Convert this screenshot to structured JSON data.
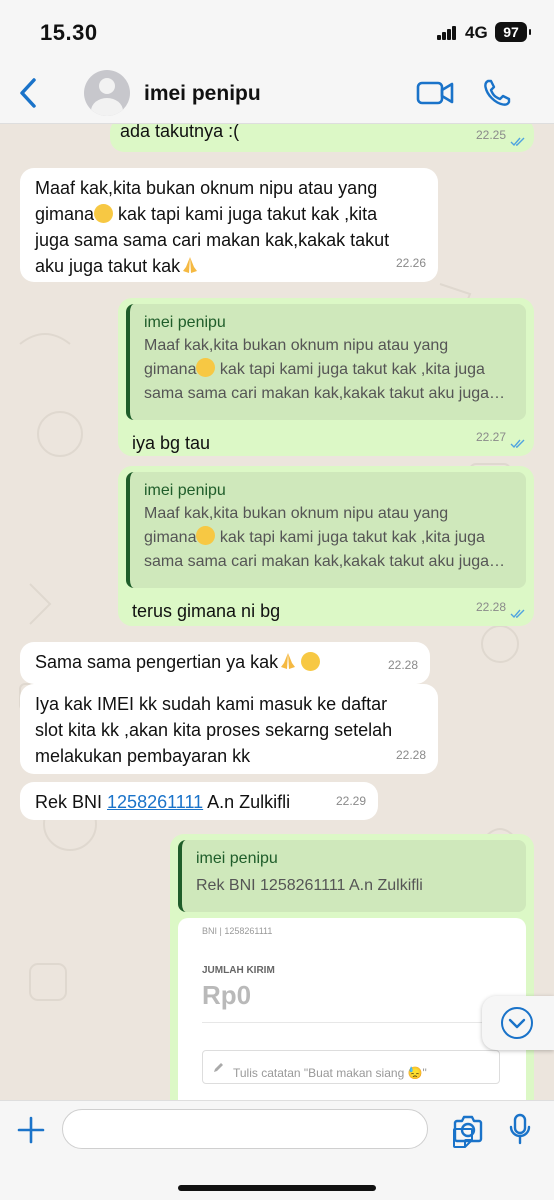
{
  "status_bar": {
    "time": "15.30",
    "network": "4G",
    "battery": "97"
  },
  "header": {
    "contact_name": "imei penipu"
  },
  "messages": [
    {
      "type": "out",
      "text": "ada takutnya :(",
      "time": "22.25"
    },
    {
      "type": "in",
      "lines": [
        "Maaf kak,kita bukan oknum nipu atau yang",
        "gimana",
        " kak tapi kami juga takut kak ,kita",
        "juga sama sama cari makan kak,kakak takut",
        "aku juga takut kak"
      ],
      "time": "22.26"
    },
    {
      "type": "out",
      "quote_name": "imei penipu",
      "quote_lines": [
        "Maaf kak,kita bukan oknum nipu atau yang",
        "gimana",
        " kak tapi kami juga takut kak ,kita juga",
        "sama sama cari makan kak,kakak takut aku juga…"
      ],
      "text": "iya bg tau",
      "time": "22.27"
    },
    {
      "type": "out",
      "quote_name": "imei penipu",
      "quote_lines": [
        "Maaf kak,kita bukan oknum nipu atau yang",
        "gimana",
        " kak tapi kami juga takut kak ,kita juga",
        "sama sama cari makan kak,kakak takut aku juga…"
      ],
      "text": "terus gimana ni bg",
      "time": "22.28"
    },
    {
      "type": "in",
      "text": "Sama sama pengertian ya kak",
      "time": "22.28"
    },
    {
      "type": "in",
      "lines": [
        "Iya kak IMEI kk sudah kami masuk ke daftar",
        "slot kita kk ,akan kita proses sekarng setelah",
        "melakukan pembayaran kk"
      ],
      "time": "22.28"
    },
    {
      "type": "in",
      "prefix": "Rek BNI ",
      "link": "1258261111",
      "suffix": " A.n Zulkifli",
      "time": "22.29"
    },
    {
      "type": "out",
      "quote_name": "imei penipu",
      "quote_text": "Rek BNI 1258261111 A.n Zulkifli",
      "image": {
        "top_text": "BNI | 1258261111",
        "label": "JUMLAH KIRIM",
        "amount": "Rp0",
        "note_placeholder": "Tulis catatan \"Buat makan siang 😓\""
      }
    }
  ],
  "colors": {
    "accent": "#1a73c9",
    "out_bubble": "#dcf8c6",
    "in_bubble": "#ffffff",
    "quote_bar": "#1f5d2a"
  }
}
